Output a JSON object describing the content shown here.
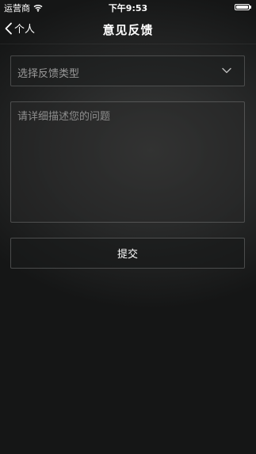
{
  "status_bar": {
    "carrier": "运营商",
    "time": "下午9:53",
    "battery_level": 1.0
  },
  "nav": {
    "back_label": "个人",
    "title": "意见反馈"
  },
  "form": {
    "type_select_placeholder": "选择反馈类型",
    "description_placeholder": "请详细描述您的问题",
    "description_value": "",
    "submit_label": "提交"
  },
  "icons": [
    "wifi-icon",
    "battery-icon",
    "chevron-left-icon",
    "chevron-down-icon"
  ],
  "colors": {
    "background": "#2a2b2b",
    "text": "#ffffff",
    "placeholder": "#9a9a9a",
    "border": "#4a4b4b"
  }
}
